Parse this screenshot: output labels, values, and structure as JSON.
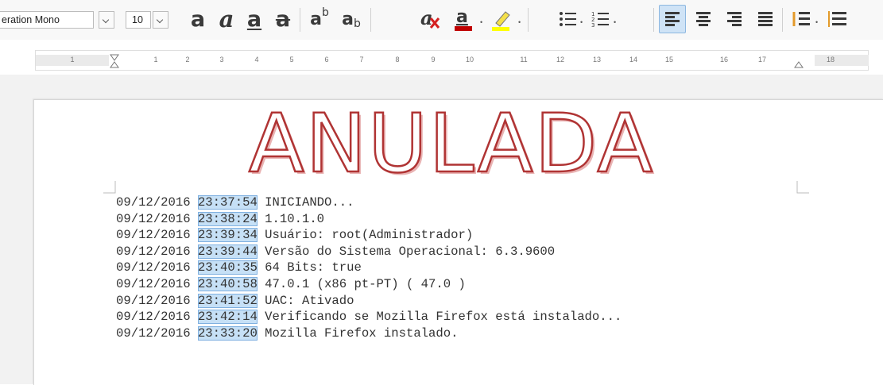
{
  "toolbar": {
    "font_name": "eration Mono",
    "font_size": "10",
    "bold_glyph": "a",
    "italic_glyph": "a",
    "underline_glyph": "a",
    "strike_glyph": "a",
    "superscript_glyph": "ab",
    "subscript_glyph": "ab",
    "font_color_glyph": "a",
    "clear_format_glyph": "a",
    "icons": [
      "bold-icon",
      "italic-icon",
      "underline-icon",
      "strikethrough-icon",
      "superscript-icon",
      "subscript-icon",
      "clear-formatting-icon",
      "font-color-icon",
      "highlight-icon",
      "bullet-list-icon",
      "numbered-list-icon",
      "align-left-icon",
      "align-center-icon",
      "align-right-icon",
      "justify-icon",
      "line-spacing-icon",
      "paragraph-spacing-icon"
    ],
    "active_alignment": "left",
    "font_color": "#c00000",
    "highlight_color": "#ffff00"
  },
  "ruler": {
    "ticks": [
      "1",
      "1",
      "2",
      "3",
      "4",
      "5",
      "6",
      "7",
      "8",
      "9",
      "10",
      "11",
      "12",
      "13",
      "14",
      "15",
      "16",
      "17",
      "18"
    ]
  },
  "document": {
    "stamp_text": "ANULADA",
    "stamp_color": "#b03434",
    "lines": [
      {
        "date": "09/12/2016",
        "time": "23:37:54",
        "text": "INICIANDO..."
      },
      {
        "date": "09/12/2016",
        "time": "23:38:24",
        "text": "1.10.1.0"
      },
      {
        "date": "09/12/2016",
        "time": "23:39:34",
        "text": "Usuário: root(Administrador)"
      },
      {
        "date": "09/12/2016",
        "time": "23:39:44",
        "text": "Versão do Sistema Operacional: 6.3.9600"
      },
      {
        "date": "09/12/2016",
        "time": "23:40:35",
        "text": "64 Bits: true"
      },
      {
        "date": "09/12/2016",
        "time": "23:40:58",
        "text": "47.0.1 (x86 pt-PT) ( 47.0 )"
      },
      {
        "date": "09/12/2016",
        "time": "23:41:52",
        "text": "UAC: Ativado"
      },
      {
        "date": "09/12/2016",
        "time": "23:42:14",
        "text": "Verificando se Mozilla Firefox está instalado..."
      },
      {
        "date": "09/12/2016",
        "time": "23:33:20",
        "text": "Mozilla Firefox instalado."
      }
    ]
  }
}
